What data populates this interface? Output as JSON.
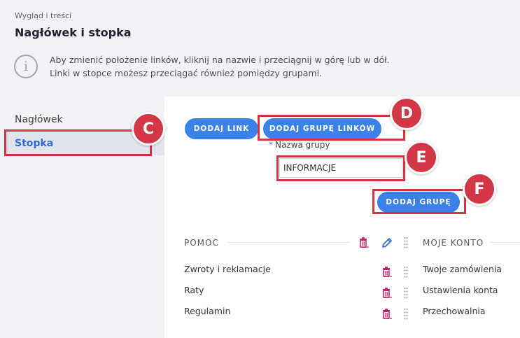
{
  "header": {
    "breadcrumb": "Wygląd i treści",
    "title": "Nagłówek i stopka"
  },
  "info": {
    "line1": "Aby zmienić położenie linków, kliknij na nazwie i przeciągnij w górę lub w dół.",
    "line2": "Linki w stopce możesz przeciągać również pomiędzy grupami."
  },
  "sidebar": {
    "items": [
      {
        "label": "Nagłówek",
        "active": false
      },
      {
        "label": "Stopka",
        "active": true
      }
    ]
  },
  "toolbar": {
    "add_link_label": "DODAJ LINK",
    "add_group_links_label": "DODAJ GRUPĘ LINKÓW"
  },
  "group_form": {
    "required_mark": "*",
    "label": "Nazwa grupy",
    "value": "INFORMACJE",
    "submit_label": "DODAJ GRUPĘ"
  },
  "callouts": {
    "c": "C",
    "d": "D",
    "e": "E",
    "f": "F"
  },
  "groups": [
    {
      "title": "POMOC",
      "links": [
        "Zwroty i reklamacje",
        "Raty",
        "Regulamin"
      ]
    },
    {
      "title": "MOJE KONTO",
      "links": [
        "Twoje zamówienia",
        "Ustawienia konta",
        "Przechowalnia"
      ]
    }
  ],
  "colors": {
    "accent": "#3b82e8",
    "highlight": "#d33645",
    "delete_icon": "#cc1f66"
  }
}
